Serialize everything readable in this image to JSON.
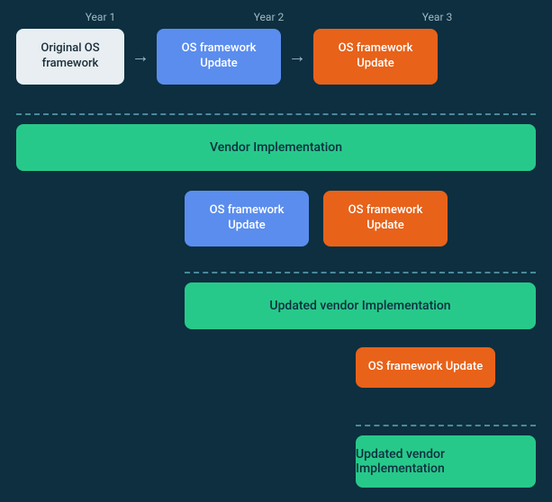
{
  "years": {
    "year1": "Year 1",
    "year2": "Year 2",
    "year3": "Year 3"
  },
  "boxes": {
    "original": "Original OS framework",
    "blue1": "OS framework Update",
    "orange1": "OS framework Update",
    "blue2": "OS framework Update",
    "orange2": "OS framework Update",
    "orange3": "OS framework Update"
  },
  "vendor": {
    "vendor1": "Vendor Implementation",
    "vendor2": "Updated vendor Implementation",
    "vendor3": "Updated vendor Implementation"
  },
  "colors": {
    "bg": "#0d2f3f",
    "original": "#e8eef2",
    "blue": "#5b8dee",
    "orange": "#e8621a",
    "green": "#27c98a",
    "dashed": "#4a8a9a",
    "yearLabel": "#a0b8c4"
  }
}
